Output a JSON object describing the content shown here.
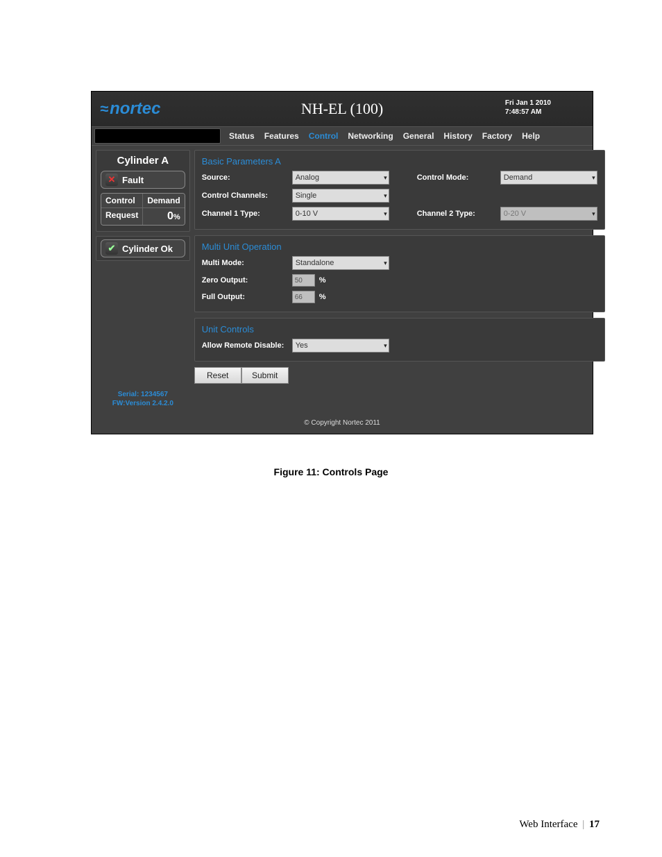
{
  "header": {
    "logo_text": "nortec",
    "title": "NH-EL (100)",
    "date_line1": "Fri Jan 1 2010",
    "date_line2": "7:48:57 AM"
  },
  "nav": {
    "items": [
      "Status",
      "Features",
      "Control",
      "Networking",
      "General",
      "History",
      "Factory",
      "Help"
    ],
    "active_index": 2
  },
  "sidebar": {
    "cylinder": {
      "heading": "Cylinder A",
      "fault_label": "Fault",
      "table": {
        "col1_header": "Control",
        "col2_header": "Demand",
        "row_label": "Request",
        "row_value": "0",
        "row_unit": "%"
      },
      "ok_label": "Cylinder Ok"
    },
    "serial_line1": "Serial: 1234567",
    "serial_line2": "FW:Version 2.4.2.0"
  },
  "panels": {
    "basic": {
      "title": "Basic Parameters A",
      "source_label": "Source:",
      "source_value": "Analog",
      "control_mode_label": "Control Mode:",
      "control_mode_value": "Demand",
      "control_channels_label": "Control Channels:",
      "control_channels_value": "Single",
      "channel1_label": "Channel 1 Type:",
      "channel1_value": "0-10 V",
      "channel2_label": "Channel 2 Type:",
      "channel2_value": "0-20 V"
    },
    "multi": {
      "title": "Multi Unit Operation",
      "multi_mode_label": "Multi Mode:",
      "multi_mode_value": "Standalone",
      "zero_label": "Zero Output:",
      "zero_value": "50",
      "zero_unit": "%",
      "full_label": "Full Output:",
      "full_value": "66",
      "full_unit": "%"
    },
    "unit": {
      "title": "Unit Controls",
      "allow_remote_label": "Allow Remote Disable:",
      "allow_remote_value": "Yes"
    },
    "buttons": {
      "reset": "Reset",
      "submit": "Submit"
    }
  },
  "footer": "© Copyright Nortec 2011",
  "caption": "Figure 11: Controls Page",
  "page_footer": {
    "section": "Web Interface",
    "sep": "|",
    "page": "17"
  }
}
